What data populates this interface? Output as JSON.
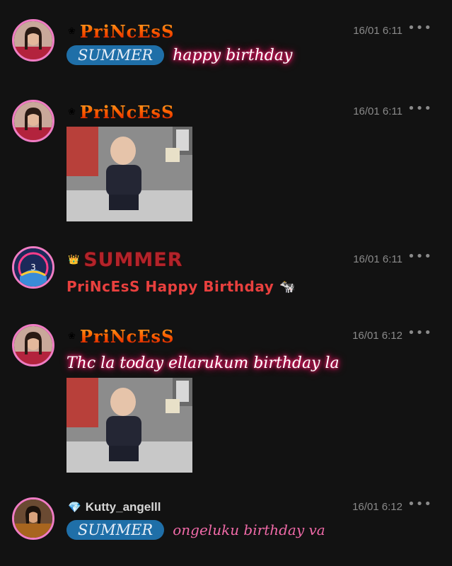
{
  "messages": [
    {
      "author": "PriNcEsS",
      "time": "16/01 6:11",
      "more": "•••",
      "mention": "SUMMER",
      "text": "happy birthday"
    },
    {
      "author": "PriNcEsS",
      "time": "16/01 6:11",
      "more": "•••",
      "attachment": "animated-gif-baby"
    },
    {
      "author": "SUMMER",
      "author_badge": "👑",
      "time": "16/01 6:11",
      "more": "•••",
      "text": "PriNcEsS Happy Birthday",
      "emoji": "🐄"
    },
    {
      "author": "PriNcEsS",
      "time": "16/01 6:12",
      "more": "•••",
      "text": "Thc la today ellarukum birthday la",
      "attachment": "animated-gif-baby"
    },
    {
      "author": "Kutty_angelll",
      "author_badge": "💎",
      "time": "16/01 6:12",
      "more": "•••",
      "mention": "SUMMER",
      "text": "ongeluku birthday va"
    }
  ],
  "colors": {
    "background": "#121212",
    "avatar_ring": "#f07cc4",
    "mention_bg": "#1f6fa8",
    "glow": "#ff1e6e",
    "red_text": "#e8403e",
    "pink_text": "#f06aa8"
  }
}
